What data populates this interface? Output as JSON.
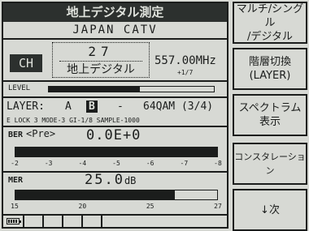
{
  "screen": {
    "title": "地上デジタル測定",
    "region": "JAPAN CATV",
    "channel": {
      "label": "CH",
      "number": "27",
      "type": "地上デジタル",
      "frequency": "557.00MHz",
      "offset": "+1/7"
    },
    "level": {
      "label": "LEVEL",
      "fraction": 0.55
    },
    "layer": {
      "label": "LAYER:",
      "option_a": "A",
      "option_b": "B",
      "option_c": "-",
      "modulation": "64QAM (3/4)",
      "details": "E LOCK 3 MODE-3 GI-1/8 SAMPLE-1000"
    },
    "ber": {
      "label": "BER",
      "sub_label": "<Pre>",
      "value": "0.0E+0",
      "fraction": 1.0,
      "ticks": [
        "-2",
        "-3",
        "-4",
        "-5",
        "-6",
        "-7",
        "-8"
      ]
    },
    "mer": {
      "label": "MER",
      "value": "25.0",
      "unit": "dB",
      "fraction": 0.79,
      "ticks": [
        "15",
        "20",
        "25",
        "27"
      ]
    }
  },
  "softkeys": [
    {
      "label": "マルチ/シングル\n/デジタル"
    },
    {
      "label": "階層切換\n(LAYER)"
    },
    {
      "label": "スペクトラム\n表示"
    },
    {
      "label": "コンスタレーション"
    },
    {
      "label": "↓次"
    }
  ]
}
